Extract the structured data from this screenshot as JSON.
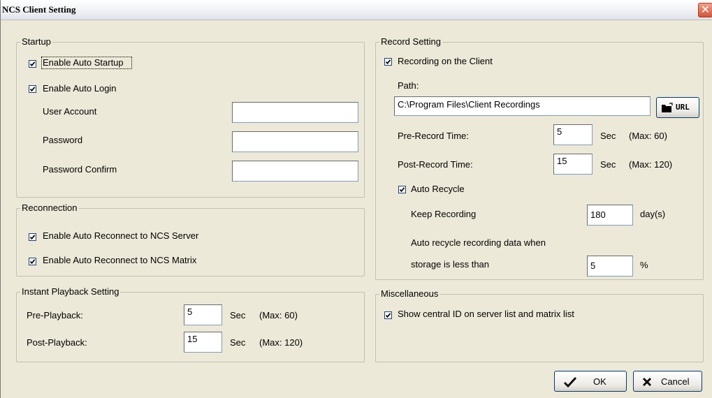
{
  "window": {
    "title": "NCS Client Setting",
    "close_glyph": "✕"
  },
  "startup": {
    "legend": "Startup",
    "auto_startup": {
      "label": "Enable Auto Startup",
      "checked": true
    },
    "auto_login": {
      "label": "Enable Auto Login",
      "checked": true
    },
    "user_account": {
      "label": "User Account",
      "value": ""
    },
    "password": {
      "label": "Password",
      "value": ""
    },
    "password_confirm": {
      "label": "Password Confirm",
      "value": ""
    }
  },
  "reconnection": {
    "legend": "Reconnection",
    "ncs_server": {
      "label": "Enable Auto Reconnect to NCS Server",
      "checked": true
    },
    "ncs_matrix": {
      "label": "Enable Auto Reconnect to NCS Matrix",
      "checked": true
    }
  },
  "playback": {
    "legend": "Instant Playback Setting",
    "pre": {
      "label": "Pre-Playback:",
      "value": "5",
      "unit": "Sec",
      "max": "(Max: 60)"
    },
    "post": {
      "label": "Post-Playback:",
      "value": "15",
      "unit": "Sec",
      "max": "(Max: 120)"
    }
  },
  "record": {
    "legend": "Record Setting",
    "on_client": {
      "label": "Recording on the Client",
      "checked": true
    },
    "path_label": "Path:",
    "path_value": "C:\\Program Files\\Client Recordings",
    "url_button": "URL",
    "pre": {
      "label": "Pre-Record Time:",
      "value": "5",
      "unit": "Sec",
      "max": "(Max: 60)"
    },
    "post": {
      "label": "Post-Record Time:",
      "value": "15",
      "unit": "Sec",
      "max": "(Max: 120)"
    },
    "auto_recycle": {
      "label": "Auto Recycle",
      "checked": true
    },
    "keep": {
      "label": "Keep Recording",
      "value": "180",
      "unit": "day(s)"
    },
    "recycle_line1": "Auto recycle recording data when",
    "recycle_line2": "storage is less than",
    "storage": {
      "value": "5",
      "unit": "%"
    }
  },
  "misc": {
    "legend": "Miscellaneous",
    "central_id": {
      "label": "Show central ID on server list and matrix list",
      "checked": true
    }
  },
  "buttons": {
    "ok": "OK",
    "cancel": "Cancel"
  }
}
